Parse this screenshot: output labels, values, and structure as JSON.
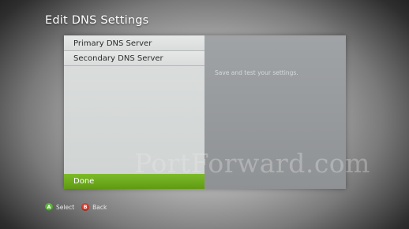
{
  "header": {
    "title": "Edit DNS Settings"
  },
  "menu": {
    "items": [
      {
        "label": "Primary DNS Server"
      },
      {
        "label": "Secondary DNS Server"
      }
    ],
    "done_label": "Done"
  },
  "info_panel": {
    "text": "Save and test your settings."
  },
  "watermark": {
    "text": "PortForward.com"
  },
  "footer": {
    "select": {
      "button": "A",
      "label": "Select"
    },
    "back": {
      "button": "B",
      "label": "Back"
    }
  },
  "colors": {
    "done_highlight": "#6fae1f",
    "button_a": "#5fb33a",
    "button_b": "#d23c2c",
    "info_panel_bg": "#989b9e"
  }
}
